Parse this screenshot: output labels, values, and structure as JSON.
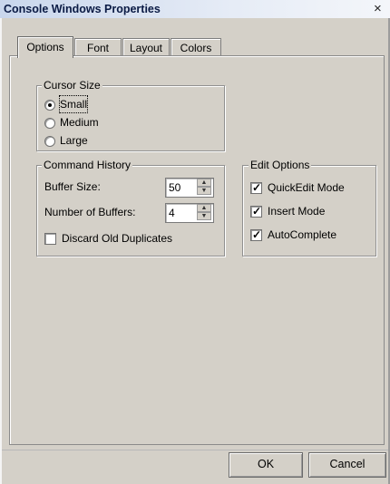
{
  "window": {
    "title": "Console Windows Properties",
    "close_glyph": "×"
  },
  "tabs": [
    {
      "label": "Options",
      "active": true
    },
    {
      "label": "Font",
      "active": false
    },
    {
      "label": "Layout",
      "active": false
    },
    {
      "label": "Colors",
      "active": false
    }
  ],
  "cursor_size": {
    "title": "Cursor Size",
    "options": [
      {
        "label": "Small",
        "selected": true
      },
      {
        "label": "Medium",
        "selected": false
      },
      {
        "label": "Large",
        "selected": false
      }
    ]
  },
  "command_history": {
    "title": "Command History",
    "buffer_size": {
      "label": "Buffer Size:",
      "value": "50"
    },
    "number_of_buffers": {
      "label": "Number of Buffers:",
      "value": "4"
    },
    "discard_old_duplicates": {
      "label": "Discard Old Duplicates",
      "checked": false
    }
  },
  "edit_options": {
    "title": "Edit Options",
    "items": [
      {
        "label": "QuickEdit Mode",
        "checked": true
      },
      {
        "label": "Insert Mode",
        "checked": true
      },
      {
        "label": "AutoComplete",
        "checked": true
      }
    ]
  },
  "buttons": {
    "ok": "OK",
    "cancel": "Cancel"
  },
  "icons": {
    "spin_up": "▲",
    "spin_down": "▼",
    "check": "✓"
  }
}
